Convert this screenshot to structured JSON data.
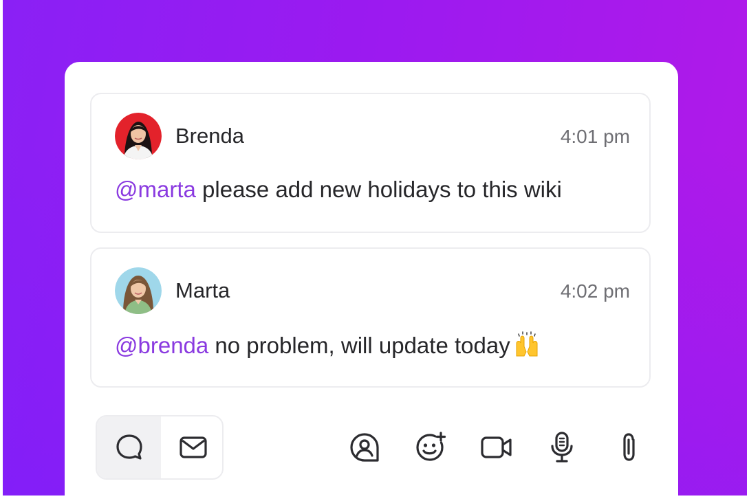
{
  "messages": [
    {
      "author": "Brenda",
      "time": "4:01 pm",
      "mention": "@marta",
      "text": " please add new holidays to this wiki",
      "avatar": "brenda-avatar"
    },
    {
      "author": "Marta",
      "time": "4:02 pm",
      "mention": "@brenda",
      "text": " no problem, will update today",
      "emoji": "🙌",
      "avatar": "marta-avatar"
    }
  ],
  "toolbar": {
    "mode_tabs": [
      "comment-icon",
      "email-icon"
    ],
    "actions": [
      "assign-mention-icon",
      "add-emoji-icon",
      "video-icon",
      "microphone-icon",
      "attachment-icon"
    ]
  },
  "colors": {
    "background_gradient_start": "#8a20f5",
    "background_gradient_end": "#b21ae8",
    "mention": "#8a3ae0",
    "text": "#262629",
    "time": "#6e6e73"
  }
}
